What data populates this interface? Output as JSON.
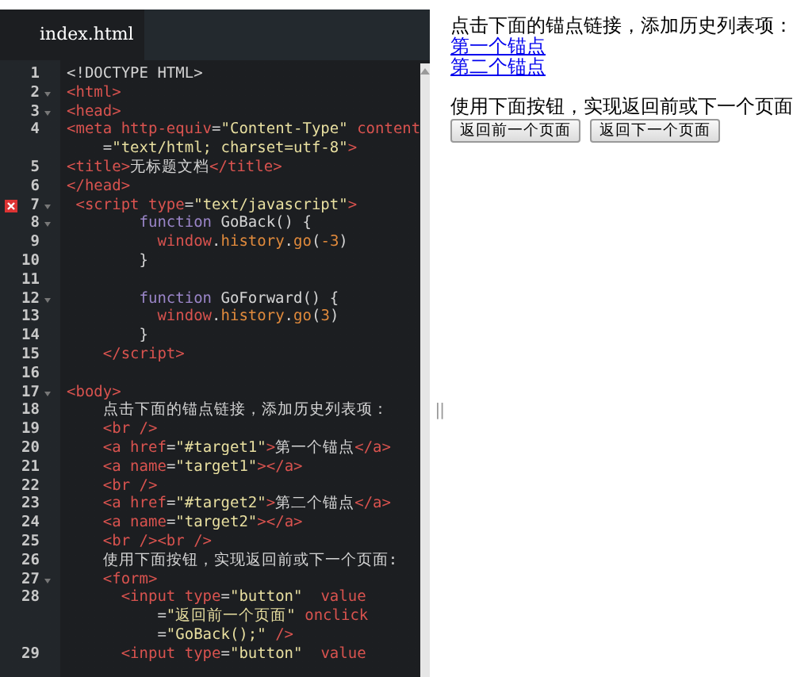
{
  "editor": {
    "tabs": [
      {
        "label": "index.html",
        "selected": true
      }
    ],
    "lines": [
      {
        "number": "1",
        "fold": false,
        "error": false,
        "parts": [
          {
            "segments": [
              {
                "kind": "text",
                "text": "<!DOCTYPE HTML>"
              }
            ]
          }
        ]
      },
      {
        "number": "2",
        "fold": true,
        "error": false,
        "parts": [
          {
            "segments": [
              {
                "kind": "tag",
                "text": "<html>"
              }
            ]
          }
        ]
      },
      {
        "number": "3",
        "fold": true,
        "error": false,
        "parts": [
          {
            "segments": [
              {
                "kind": "tag",
                "text": "<head>"
              }
            ]
          }
        ]
      },
      {
        "number": "4",
        "fold": false,
        "error": false,
        "parts": [
          {
            "segments": [
              {
                "kind": "tag",
                "text": "<meta "
              },
              {
                "kind": "attr",
                "text": "http-equiv"
              },
              {
                "kind": "text",
                "text": "="
              },
              {
                "kind": "string",
                "text": "\"Content-Type\""
              },
              {
                "kind": "attr",
                "text": " content"
              }
            ]
          },
          {
            "segments": [
              {
                "kind": "text",
                "text": "    ="
              },
              {
                "kind": "string",
                "text": "\"text/html; charset=utf-8\""
              },
              {
                "kind": "tag",
                "text": ">"
              }
            ]
          }
        ]
      },
      {
        "number": "5",
        "fold": false,
        "error": false,
        "parts": [
          {
            "segments": [
              {
                "kind": "tag",
                "text": "<title>"
              },
              {
                "kind": "text",
                "text": "无标题文档"
              },
              {
                "kind": "tag",
                "text": "</title>"
              }
            ]
          }
        ]
      },
      {
        "number": "6",
        "fold": false,
        "error": false,
        "parts": [
          {
            "segments": [
              {
                "kind": "tag",
                "text": "</head>"
              }
            ]
          }
        ]
      },
      {
        "number": "7",
        "fold": true,
        "error": true,
        "parts": [
          {
            "segments": [
              {
                "kind": "tag",
                "text": " <script "
              },
              {
                "kind": "attr",
                "text": "type"
              },
              {
                "kind": "text",
                "text": "="
              },
              {
                "kind": "string",
                "text": "\"text/javascript\""
              },
              {
                "kind": "tag",
                "text": ">"
              }
            ]
          }
        ]
      },
      {
        "number": "8",
        "fold": true,
        "error": false,
        "parts": [
          {
            "segments": [
              {
                "kind": "keyword",
                "text": "        function "
              },
              {
                "kind": "text",
                "text": "GoBack() {"
              }
            ]
          }
        ]
      },
      {
        "number": "9",
        "fold": false,
        "error": false,
        "parts": [
          {
            "segments": [
              {
                "kind": "var",
                "text": "          window"
              },
              {
                "kind": "text",
                "text": "."
              },
              {
                "kind": "prop",
                "text": "history"
              },
              {
                "kind": "text",
                "text": "."
              },
              {
                "kind": "prop",
                "text": "go"
              },
              {
                "kind": "text",
                "text": "("
              },
              {
                "kind": "number",
                "text": "-3"
              },
              {
                "kind": "text",
                "text": ")"
              }
            ]
          }
        ]
      },
      {
        "number": "10",
        "fold": false,
        "error": false,
        "parts": [
          {
            "segments": [
              {
                "kind": "text",
                "text": "        }"
              }
            ]
          }
        ]
      },
      {
        "number": "11",
        "fold": false,
        "error": false
      },
      {
        "number": "12",
        "fold": true,
        "error": false,
        "parts": [
          {
            "segments": [
              {
                "kind": "keyword",
                "text": "        function "
              },
              {
                "kind": "text",
                "text": "GoForward() {"
              }
            ]
          }
        ]
      },
      {
        "number": "13",
        "fold": false,
        "error": false,
        "parts": [
          {
            "segments": [
              {
                "kind": "var",
                "text": "          window"
              },
              {
                "kind": "text",
                "text": "."
              },
              {
                "kind": "prop",
                "text": "history"
              },
              {
                "kind": "text",
                "text": "."
              },
              {
                "kind": "prop",
                "text": "go"
              },
              {
                "kind": "text",
                "text": "("
              },
              {
                "kind": "number",
                "text": "3"
              },
              {
                "kind": "text",
                "text": ")"
              }
            ]
          }
        ]
      },
      {
        "number": "14",
        "fold": false,
        "error": false,
        "parts": [
          {
            "segments": [
              {
                "kind": "text",
                "text": "        }"
              }
            ]
          }
        ]
      },
      {
        "number": "15",
        "fold": false,
        "error": false,
        "parts": [
          {
            "segments": [
              {
                "kind": "tag",
                "text": "    </script>"
              }
            ]
          }
        ]
      },
      {
        "number": "16",
        "fold": false,
        "error": false
      },
      {
        "number": "17",
        "fold": true,
        "error": false,
        "parts": [
          {
            "segments": [
              {
                "kind": "tag",
                "text": "<body>"
              }
            ]
          }
        ]
      },
      {
        "number": "18",
        "fold": false,
        "error": false,
        "parts": [
          {
            "segments": [
              {
                "kind": "text",
                "text": "    点击下面的锚点链接，添加历史列表项："
              }
            ]
          }
        ]
      },
      {
        "number": "19",
        "fold": false,
        "error": false,
        "parts": [
          {
            "segments": [
              {
                "kind": "tag",
                "text": "    <br />"
              }
            ]
          }
        ]
      },
      {
        "number": "20",
        "fold": false,
        "error": false,
        "parts": [
          {
            "segments": [
              {
                "kind": "tag",
                "text": "    <a "
              },
              {
                "kind": "attr",
                "text": "href"
              },
              {
                "kind": "text",
                "text": "="
              },
              {
                "kind": "string",
                "text": "\"#target1\""
              },
              {
                "kind": "tag",
                "text": ">"
              },
              {
                "kind": "text",
                "text": "第一个锚点"
              },
              {
                "kind": "tag",
                "text": "</a>"
              }
            ]
          }
        ]
      },
      {
        "number": "21",
        "fold": false,
        "error": false,
        "parts": [
          {
            "segments": [
              {
                "kind": "tag",
                "text": "    <a "
              },
              {
                "kind": "attr",
                "text": "name"
              },
              {
                "kind": "text",
                "text": "="
              },
              {
                "kind": "string",
                "text": "\"target1\""
              },
              {
                "kind": "tag",
                "text": "></a>"
              }
            ]
          }
        ]
      },
      {
        "number": "22",
        "fold": false,
        "error": false,
        "parts": [
          {
            "segments": [
              {
                "kind": "tag",
                "text": "    <br />"
              }
            ]
          }
        ]
      },
      {
        "number": "23",
        "fold": false,
        "error": false,
        "parts": [
          {
            "segments": [
              {
                "kind": "tag",
                "text": "    <a "
              },
              {
                "kind": "attr",
                "text": "href"
              },
              {
                "kind": "text",
                "text": "="
              },
              {
                "kind": "string",
                "text": "\"#target2\""
              },
              {
                "kind": "tag",
                "text": ">"
              },
              {
                "kind": "text",
                "text": "第二个锚点"
              },
              {
                "kind": "tag",
                "text": "</a>"
              }
            ]
          }
        ]
      },
      {
        "number": "24",
        "fold": false,
        "error": false,
        "parts": [
          {
            "segments": [
              {
                "kind": "tag",
                "text": "    <a "
              },
              {
                "kind": "attr",
                "text": "name"
              },
              {
                "kind": "text",
                "text": "="
              },
              {
                "kind": "string",
                "text": "\"target2\""
              },
              {
                "kind": "tag",
                "text": "></a>"
              }
            ]
          }
        ]
      },
      {
        "number": "25",
        "fold": false,
        "error": false,
        "parts": [
          {
            "segments": [
              {
                "kind": "tag",
                "text": "    <br /><br />"
              }
            ]
          }
        ]
      },
      {
        "number": "26",
        "fold": false,
        "error": false,
        "parts": [
          {
            "segments": [
              {
                "kind": "text",
                "text": "    使用下面按钮，实现返回前或下一个页面:"
              }
            ]
          }
        ]
      },
      {
        "number": "27",
        "fold": true,
        "error": false,
        "parts": [
          {
            "segments": [
              {
                "kind": "tag",
                "text": "    <form>"
              }
            ]
          }
        ]
      },
      {
        "number": "28",
        "fold": false,
        "error": false,
        "parts": [
          {
            "segments": [
              {
                "kind": "tag",
                "text": "      <input "
              },
              {
                "kind": "attr",
                "text": "type"
              },
              {
                "kind": "text",
                "text": "="
              },
              {
                "kind": "string",
                "text": "\"button\""
              },
              {
                "kind": "attr",
                "text": "  value"
              }
            ]
          },
          {
            "segments": [
              {
                "kind": "text",
                "text": "          ="
              },
              {
                "kind": "string",
                "text": "\"返回前一个页面\""
              },
              {
                "kind": "attr",
                "text": " onclick"
              }
            ]
          },
          {
            "segments": [
              {
                "kind": "text",
                "text": "          ="
              },
              {
                "kind": "string",
                "text": "\"GoBack();\""
              },
              {
                "kind": "tag",
                "text": " />"
              }
            ]
          }
        ]
      },
      {
        "number": "29",
        "fold": false,
        "error": false,
        "parts": [
          {
            "segments": [
              {
                "kind": "tag",
                "text": "      <input "
              },
              {
                "kind": "attr",
                "text": "type"
              },
              {
                "kind": "text",
                "text": "="
              },
              {
                "kind": "string",
                "text": "\"button\""
              },
              {
                "kind": "attr",
                "text": "  value"
              }
            ]
          }
        ]
      }
    ],
    "divider_handle": "||"
  },
  "preview": {
    "intro": "点击下面的锚点链接，添加历史列表项：",
    "links": [
      "第一个锚点",
      "第二个锚点"
    ],
    "instruction": "使用下面按钮，实现返回前或下一个页面",
    "buttons": [
      "返回前一个页面",
      "返回下一个页面"
    ]
  }
}
